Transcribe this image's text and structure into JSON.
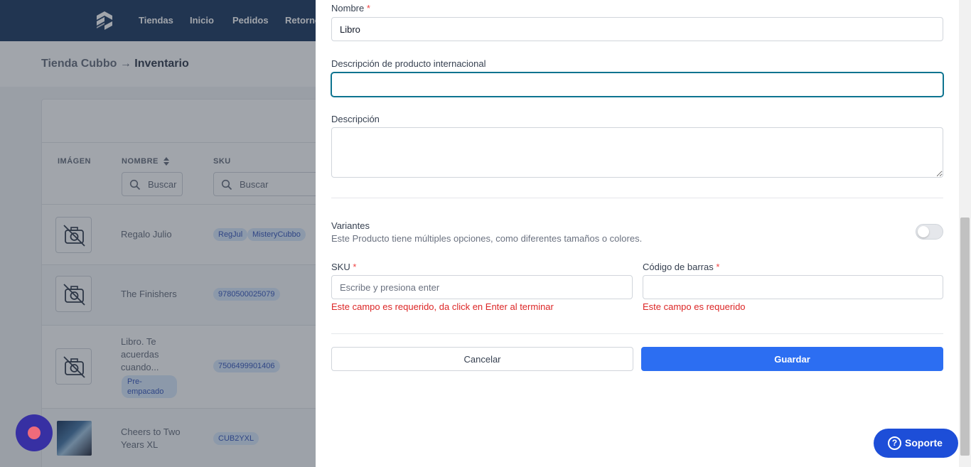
{
  "nav": {
    "items": [
      "Tiendas",
      "Inicio",
      "Pedidos",
      "Retornos"
    ]
  },
  "breadcrumb": {
    "parent": "Tienda Cubbo",
    "arrow": "→",
    "current": "Inventario"
  },
  "table": {
    "headers": {
      "image": "IMÁGEN",
      "name": "NOMBRE",
      "sku": "SKU"
    },
    "search_placeholder": "Buscar",
    "rows": [
      {
        "name": "Regalo Julio",
        "tags": [
          "RegJul",
          "MisteryCubbo"
        ],
        "has_image": false
      },
      {
        "name": "The Finishers",
        "tags": [
          "9780500025079"
        ],
        "has_image": false
      },
      {
        "name": "Libro. Te acuerdas cuando...",
        "badge": "Pre-empacado",
        "tags": [
          "7506499901406"
        ],
        "has_image": false
      },
      {
        "name": "Cheers to Two Years XL",
        "tags": [
          "CUB2YXL"
        ],
        "has_image": true
      }
    ]
  },
  "form": {
    "name_label": "Nombre",
    "required_mark": "*",
    "name_value": "Libro",
    "intl_desc_label": "Descripción de producto internacional",
    "intl_desc_value": "",
    "desc_label": "Descripción",
    "desc_value": "",
    "variants_title": "Variantes",
    "variants_help": "Este Producto tiene múltiples opciones, como diferentes tamaños o colores.",
    "variants_enabled": false,
    "sku_label": "SKU",
    "sku_placeholder": "Escribe y presiona enter",
    "sku_error": "Este campo es requerido, da click en Enter al terminar",
    "barcode_label": "Código de barras",
    "barcode_value": "",
    "barcode_error": "Este campo es requerido",
    "cancel_label": "Cancelar",
    "save_label": "Guardar"
  },
  "support": {
    "label": "Soporte",
    "icon": "?"
  },
  "colors": {
    "nav": "#233e64",
    "primary": "#2c6ef2",
    "error": "#dc2626",
    "support": "#1d4ed8",
    "fab": "#3730a3"
  }
}
